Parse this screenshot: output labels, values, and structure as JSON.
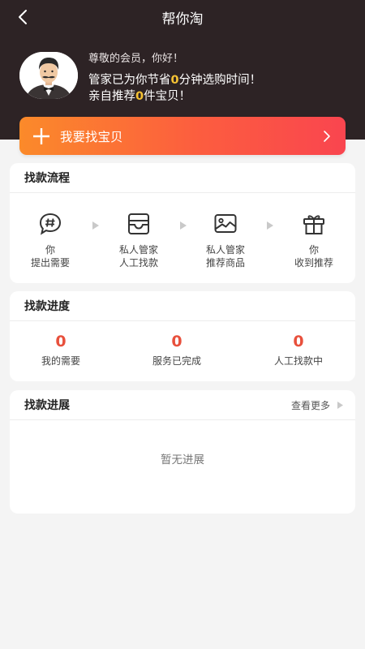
{
  "nav": {
    "title": "帮你淘"
  },
  "header": {
    "greeting": "尊敬的会员，你好！",
    "saved_prefix": "管家已为你节省",
    "saved_minutes": "0",
    "saved_suffix": "分钟选购时间！",
    "rec_prefix": "亲自推荐",
    "rec_count": "0",
    "rec_suffix": "件宝贝！"
  },
  "cta": {
    "label": "我要找宝贝"
  },
  "flow": {
    "title": "找款流程",
    "steps": [
      {
        "line1": "你",
        "line2": "提出需要",
        "icon": "hashtag-chat-icon"
      },
      {
        "line1": "私人管家",
        "line2": "人工找款",
        "icon": "wallet-box-icon"
      },
      {
        "line1": "私人管家",
        "line2": "推荐商品",
        "icon": "image-icon"
      },
      {
        "line1": "你",
        "line2": "收到推荐",
        "icon": "gift-icon"
      }
    ]
  },
  "progress": {
    "title": "找款进度",
    "stats": [
      {
        "value": "0",
        "label": "我的需要"
      },
      {
        "value": "0",
        "label": "服务已完成"
      },
      {
        "value": "0",
        "label": "人工找款中"
      }
    ]
  },
  "development": {
    "title": "找款进展",
    "more_label": "查看更多",
    "empty_text": "暂无进展"
  },
  "colors": {
    "header_bg": "#2d2325",
    "highlight": "#f6c334",
    "accent": "#e8503c",
    "cta_start": "#fb8a2a",
    "cta_end": "#f9454f"
  }
}
